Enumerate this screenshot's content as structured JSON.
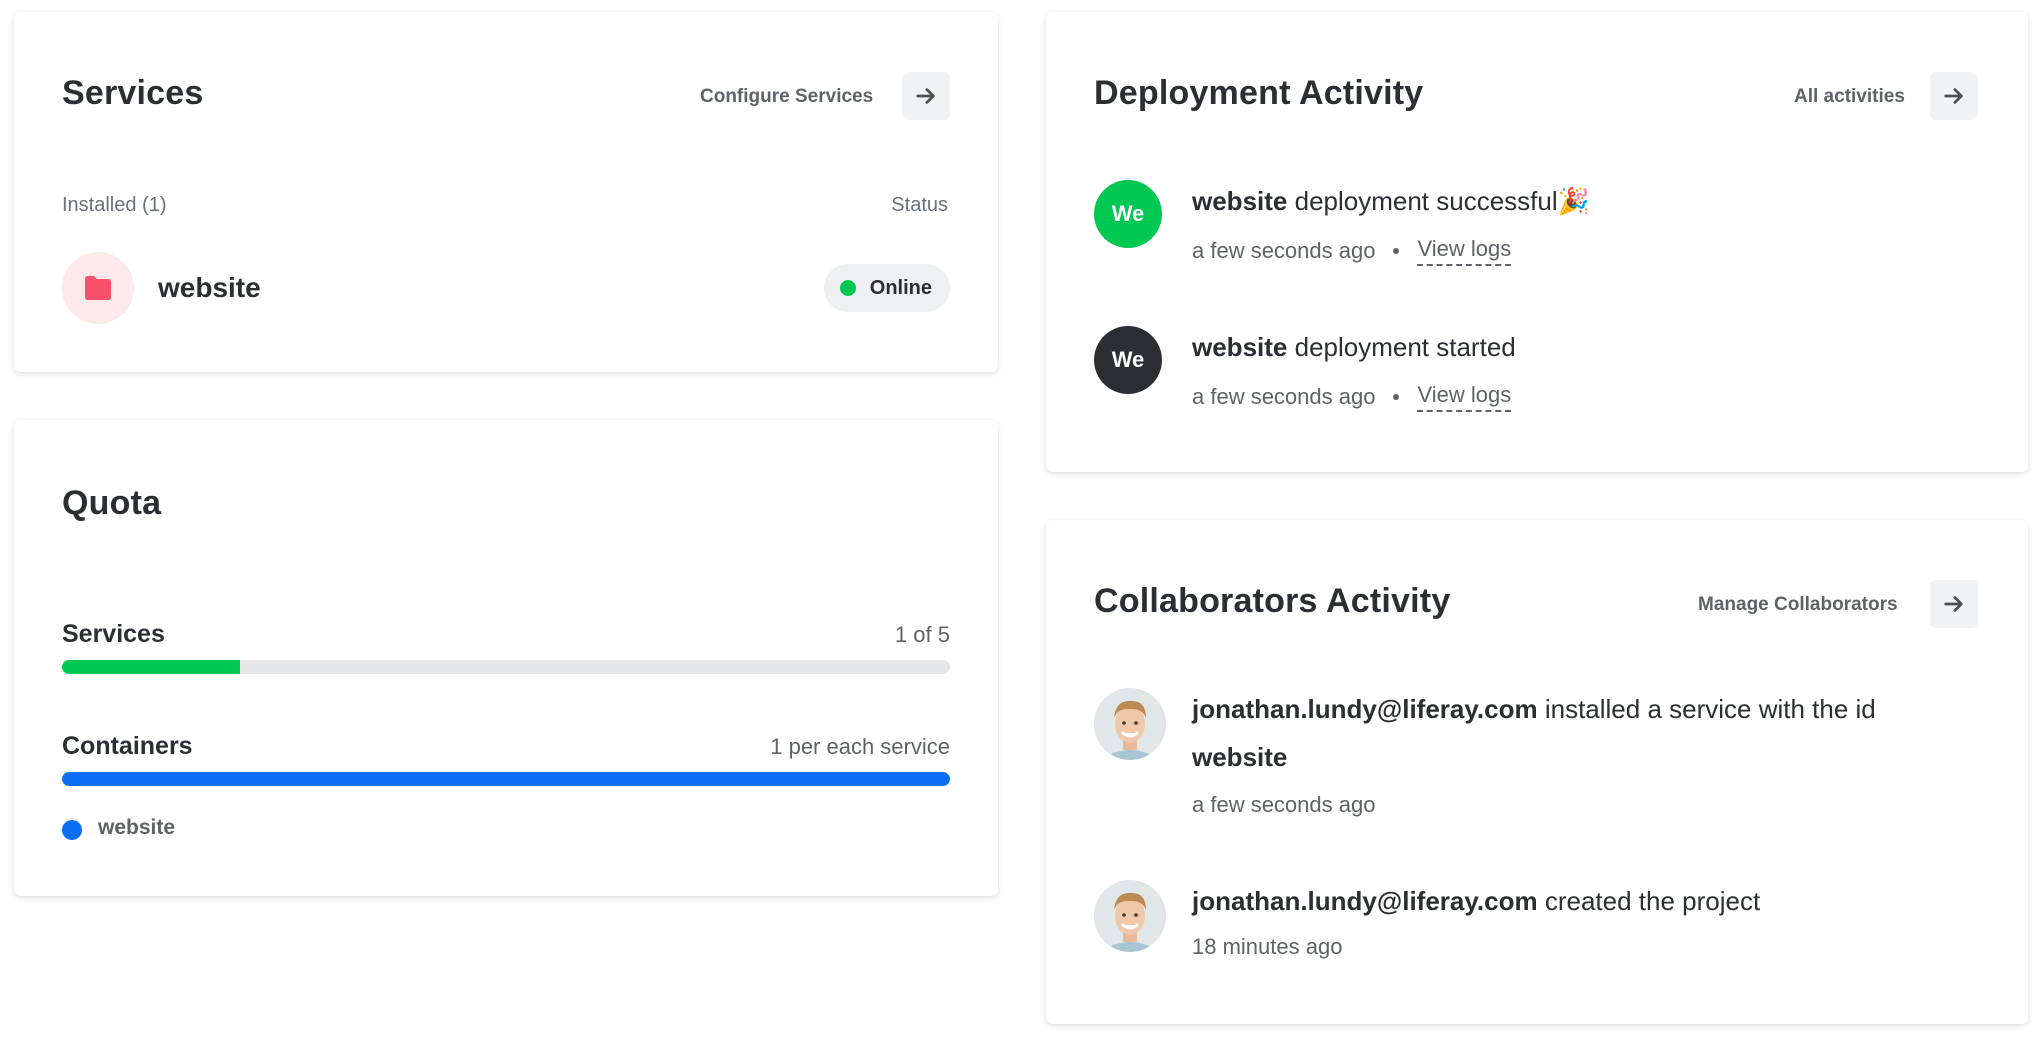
{
  "services_card": {
    "title": "Services",
    "configure_label": "Configure Services",
    "installed_label": "Installed (1)",
    "status_label": "Status",
    "service": {
      "name": "website",
      "status": "Online",
      "icon": "folder-icon",
      "status_color": "#00c853"
    }
  },
  "quota_card": {
    "title": "Quota",
    "services": {
      "label": "Services",
      "value": "1 of 5",
      "used_fraction": 0.2,
      "color": "#00c853"
    },
    "containers": {
      "label": "Containers",
      "value": "1 per each service",
      "used_fraction": 1.0,
      "color": "#0b6ff5"
    },
    "legend": [
      {
        "label": "website",
        "color": "#0b6ff5"
      }
    ]
  },
  "deployment_card": {
    "title": "Deployment Activity",
    "all_label": "All activities",
    "items": [
      {
        "avatar_text": "We",
        "avatar_color": "#00c853",
        "subject": "website",
        "text": "deployment successful",
        "emoji": "🎉",
        "time": "a few seconds ago",
        "link": "View logs"
      },
      {
        "avatar_text": "We",
        "avatar_color": "#2b2e33",
        "subject": "website",
        "text": "deployment started",
        "time": "a few seconds ago",
        "link": "View logs"
      }
    ]
  },
  "collaborators_card": {
    "title": "Collaborators Activity",
    "manage_label": "Manage Collaborators",
    "items": [
      {
        "user": "jonathan.lundy@liferay.com",
        "text": "installed a service with the id",
        "object": "website",
        "time": "a few seconds ago"
      },
      {
        "user": "jonathan.lundy@liferay.com",
        "text": "created the project",
        "time": "18 minutes ago"
      }
    ]
  },
  "icons": {
    "arrow": "arrow-right-icon",
    "folder": "folder-icon"
  }
}
